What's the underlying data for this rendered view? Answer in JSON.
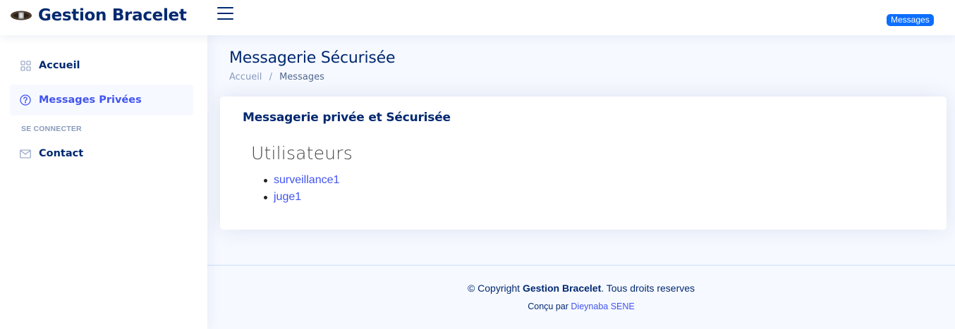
{
  "header": {
    "logo_text": "Gestion Bracelet",
    "logo_icon": "bracelet-icon",
    "toggle_icon": "hamburger-menu-icon",
    "messages_badge": "Messages"
  },
  "sidebar": {
    "items": [
      {
        "label": "Accueil",
        "icon": "grid-icon",
        "active": false
      },
      {
        "label": "Messages Privées",
        "icon": "question-circle-icon",
        "active": true
      }
    ],
    "heading": "Se connecter",
    "contact": {
      "label": "Contact",
      "icon": "envelope-icon"
    }
  },
  "page": {
    "title": "Messagerie Sécurisée",
    "breadcrumb": [
      "Accueil",
      "/",
      "Messages"
    ]
  },
  "card": {
    "title": "Messagerie privée et Sécurisée",
    "users_heading": "Utilisateurs",
    "users": [
      "surveillance1",
      "juge1"
    ]
  },
  "footer": {
    "copyright_prefix": "© Copyright ",
    "brand": "Gestion Bracelet",
    "copyright_suffix": ". Tous droits reserves",
    "credits_prefix": "Conçu par ",
    "author": "Dieynaba SENE"
  },
  "colors": {
    "primary_dark": "#012970",
    "accent": "#4154f1",
    "badge": "#0d6efd",
    "background": "#f6f9ff"
  }
}
